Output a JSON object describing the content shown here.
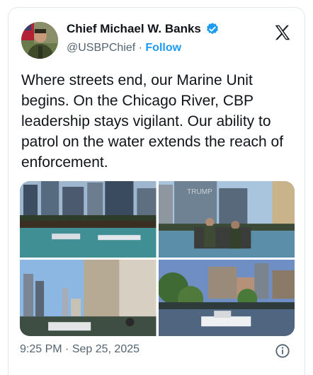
{
  "author": {
    "name": "Chief Michael W. Banks",
    "handle": "@USBPChief",
    "separator": "·",
    "follow_label": "Follow"
  },
  "tweet": {
    "text": "Where streets end, our Marine Unit begins. On the Chicago River, CBP leadership stays vigilant. Our ability to patrol on the water extends the reach of enforcement."
  },
  "media": {
    "photos": [
      {
        "description_icon": "photo"
      },
      {
        "description_icon": "photo"
      },
      {
        "description_icon": "photo"
      },
      {
        "description_icon": "photo"
      }
    ],
    "building_sign": "TRUMP"
  },
  "meta": {
    "time": "9:25 PM",
    "separator": "·",
    "date": "Sep 25, 2025"
  },
  "colors": {
    "accent": "#1d9bf0",
    "text": "#0f1419",
    "muted": "#536471"
  }
}
